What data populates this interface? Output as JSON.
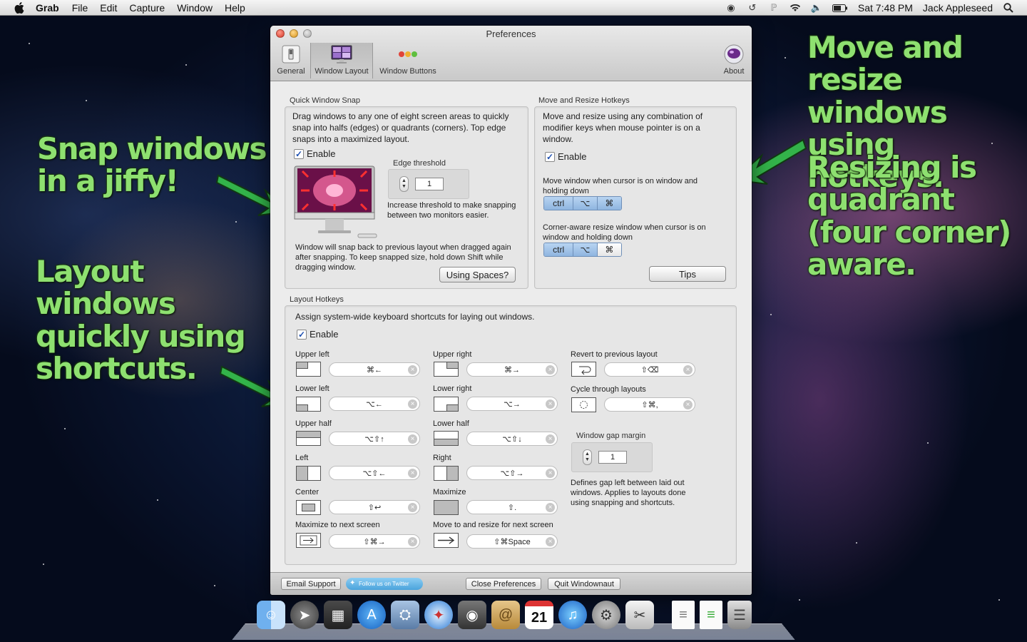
{
  "menubar": {
    "app_name": "Grab",
    "items": [
      "File",
      "Edit",
      "Capture",
      "Window",
      "Help"
    ],
    "clock": "Sat 7:48 PM",
    "user": "Jack Appleseed"
  },
  "callouts": {
    "snap": "Snap windows\nin a jiffy!",
    "layout": "Layout\nwindows\nquickly using\nshortcuts.",
    "move": "Move and\nresize windows\nusing hotkeys.",
    "resize": "Resizing is\nquadrant\n(four corner)\naware."
  },
  "window": {
    "title": "Preferences",
    "toolbar": {
      "general": "General",
      "window_layout": "Window Layout",
      "window_buttons": "Window Buttons",
      "about": "About"
    },
    "quick_snap": {
      "heading": "Quick Window Snap",
      "description": "Drag windows to any one of eight screen areas to quickly snap into halfs (edges) or quadrants (corners). Top edge snaps into a maximized layout.",
      "enable_label": "Enable",
      "edge_threshold_label": "Edge threshold",
      "edge_threshold_value": "1",
      "threshold_note": "Increase threshold to make snapping between two monitors easier.",
      "snap_back_note": "Window will snap back to previous layout when dragged again after snapping. To keep snapped size, hold down Shift while dragging window.",
      "spaces_button": "Using Spaces?"
    },
    "move_resize": {
      "heading": "Move and Resize Hotkeys",
      "description": "Move and resize using any combination of modifier keys when mouse pointer is on a window.",
      "enable_label": "Enable",
      "move_label": "Move window when cursor is on window and holding down",
      "corner_label": "Corner-aware resize window when cursor is on window and holding down",
      "modifier_keys": [
        "ctrl",
        "⌥",
        "⌘"
      ],
      "tips_button": "Tips"
    },
    "layout_hotkeys": {
      "heading": "Layout Hotkeys",
      "description": "Assign system-wide keyboard shortcuts for laying out windows.",
      "enable_label": "Enable",
      "items": [
        {
          "label": "Upper left",
          "shortcut": "⌘←"
        },
        {
          "label": "Upper right",
          "shortcut": "⌘→"
        },
        {
          "label": "Revert to previous layout",
          "shortcut": "⇧⌫"
        },
        {
          "label": "Lower left",
          "shortcut": "⌥←"
        },
        {
          "label": "Lower right",
          "shortcut": "⌥→"
        },
        {
          "label": "Cycle through layouts",
          "shortcut": "⇧⌘,"
        },
        {
          "label": "Upper half",
          "shortcut": "⌥⇧↑"
        },
        {
          "label": "Lower half",
          "shortcut": "⌥⇧↓"
        },
        {
          "label": "Left",
          "shortcut": "⌥⇧←"
        },
        {
          "label": "Right",
          "shortcut": "⌥⇧→"
        },
        {
          "label": "Center",
          "shortcut": "⇧↩"
        },
        {
          "label": "Maximize",
          "shortcut": "⇧."
        },
        {
          "label": "Maximize to next screen",
          "shortcut": "⇧⌘→"
        },
        {
          "label": "Move to and resize for next screen",
          "shortcut": "⇧⌘Space"
        }
      ],
      "gap_margin_label": "Window gap margin",
      "gap_margin_value": "1",
      "gap_note": "Defines gap left between laid out windows. Applies to layouts done using snapping and shortcuts."
    },
    "footer": {
      "email_support": "Email Support",
      "twitter": "Follow us on Twitter",
      "close_preferences": "Close Preferences",
      "quit": "Quit Windownaut"
    }
  },
  "colors": {
    "callout_green": "#8ee070",
    "arrow_green": "#33b34a",
    "selected_segment": "#a6c6ea"
  },
  "dock": {
    "icons": [
      "finder-icon",
      "launchpad-icon",
      "mission-control-icon",
      "app-store-icon",
      "preview-icon",
      "safari-icon",
      "facetime-icon",
      "contacts-icon",
      "calendar-icon",
      "itunes-icon",
      "system-preferences-icon",
      "windownaut-icon",
      "document-icon",
      "document-icon",
      "trash-icon"
    ],
    "calendar_day": "21"
  }
}
